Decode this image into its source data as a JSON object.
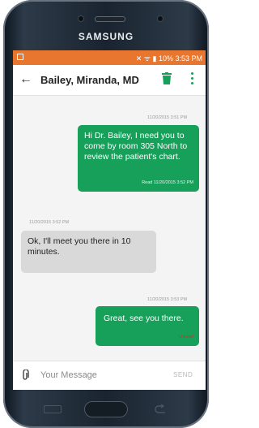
{
  "device": {
    "brand": "SAMSUNG"
  },
  "status_bar": {
    "battery_time": "10% 3:53 PM"
  },
  "app_bar": {
    "title": "Bailey, Miranda, MD"
  },
  "messages": [
    {
      "timestamp": "11/20/2015 3:51 PM",
      "text": "Hi Dr. Bailey, I need you to come by room 305 North to review the patient's chart.",
      "status": "Read 11/20/2015 3:52 PM"
    },
    {
      "timestamp": "11/20/2015 3:52 PM",
      "text": "Ok, I'll meet you there in 10 minutes."
    },
    {
      "timestamp": "11/20/2015 3:53 PM",
      "text": "Great, see you there.",
      "status": "Unread"
    }
  ],
  "composer": {
    "placeholder": "Your Message",
    "send_label": "SEND"
  },
  "colors": {
    "accent": "#16a05a",
    "status_bar": "#e8762e",
    "unread": "#c0392b"
  }
}
